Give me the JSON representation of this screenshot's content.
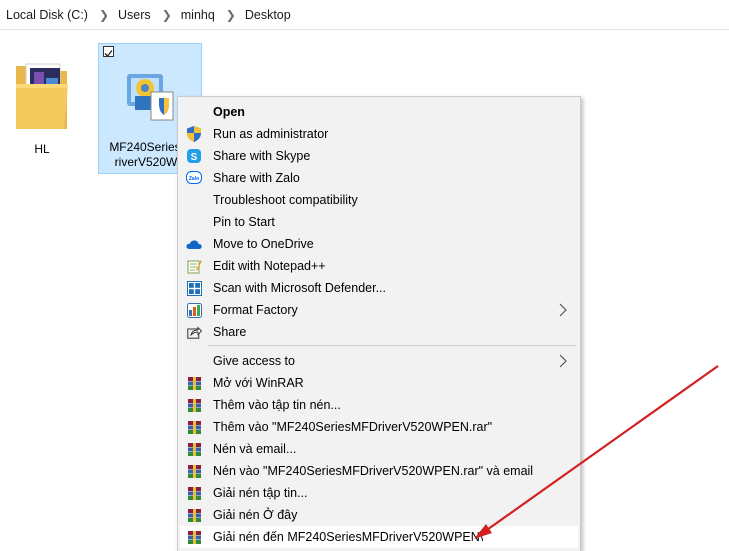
{
  "breadcrumb": {
    "items": [
      "Local Disk (C:)",
      "Users",
      "minhq",
      "Desktop"
    ]
  },
  "desktop": {
    "folder": {
      "label": "HL"
    },
    "exe": {
      "label_line1": "MF240SeriesM",
      "label_line2": "riverV520WP"
    }
  },
  "context_menu": {
    "items": [
      {
        "label": "Open",
        "icon": "none"
      },
      {
        "label": "Run as administrator",
        "icon": "uac-shield-icon"
      },
      {
        "label": "Share with Skype",
        "icon": "skype-icon"
      },
      {
        "label": "Share with Zalo",
        "icon": "zalo-icon"
      },
      {
        "label": "Troubleshoot compatibility",
        "icon": "none"
      },
      {
        "label": "Pin to Start",
        "icon": "none"
      },
      {
        "label": "Move to OneDrive",
        "icon": "onedrive-icon"
      },
      {
        "label": "Edit with Notepad++",
        "icon": "notepadpp-icon"
      },
      {
        "label": "Scan with Microsoft Defender...",
        "icon": "defender-icon"
      },
      {
        "label": "Format Factory",
        "icon": "format-factory-icon"
      },
      {
        "label": "Share",
        "icon": "share-icon"
      },
      {
        "label": "Give access to",
        "icon": "none"
      },
      {
        "label": "Mở với WinRAR",
        "icon": "winrar-icon"
      },
      {
        "label": "Thêm vào tập tin nén...",
        "icon": "winrar-icon"
      },
      {
        "label": "Thêm vào \"MF240SeriesMFDriverV520WPEN.rar\"",
        "icon": "winrar-icon"
      },
      {
        "label": "Nén và email...",
        "icon": "winrar-icon"
      },
      {
        "label": "Nén vào \"MF240SeriesMFDriverV520WPEN.rar\" và email",
        "icon": "winrar-icon"
      },
      {
        "label": "Giải nén tập tin...",
        "icon": "winrar-icon"
      },
      {
        "label": "Giải nén Ở đây",
        "icon": "winrar-icon"
      },
      {
        "label": "Giải nén đến MF240SeriesMFDriverV520WPEN\\",
        "icon": "winrar-icon"
      }
    ]
  },
  "colors": {
    "selection_bg": "#cce8ff",
    "selection_border": "#99d1ff",
    "menu_bg": "#f2f2f2",
    "annotation_arrow": "#d42020"
  }
}
